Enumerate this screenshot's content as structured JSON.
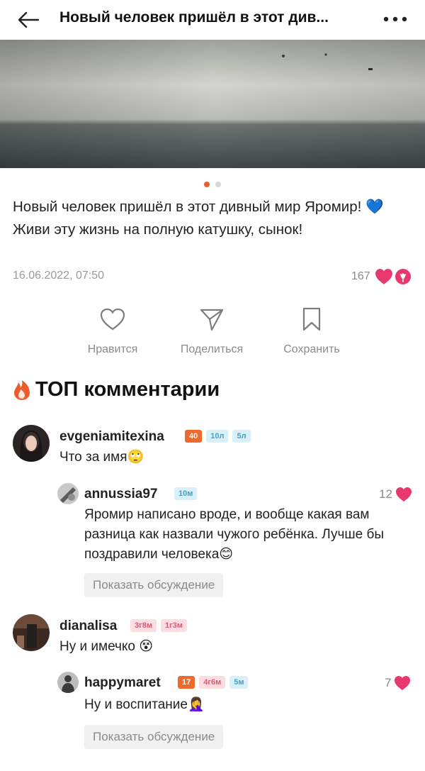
{
  "header": {
    "title": "Новый человек пришёл в этот див..."
  },
  "post": {
    "text": "Новый человек пришёл в этот дивный мир Яромир! 💙 Живи эту жизнь на полную катушку, сынок!",
    "date": "16.06.2022, 07:50",
    "likes": "167",
    "photo_slides": 2,
    "active_slide": 1
  },
  "actions": {
    "like_label": "Нравится",
    "share_label": "Поделиться",
    "save_label": "Сохранить"
  },
  "top_comments": {
    "title": "ТОП комментарии"
  },
  "comments": [
    {
      "username": "evgeniamitexina",
      "badges": [
        "40",
        "10л",
        "5л"
      ],
      "text": "Что за имя🙄",
      "reply": {
        "username": "annussia97",
        "badges": [
          "10м"
        ],
        "likes": "12",
        "text": "Яромир написано вроде, и вообще какая вам разница как назвали чужого ребёнка. Лучше бы поздравили человека😊",
        "show_discussion": "Показать обсуждение"
      }
    },
    {
      "username": "dianalisa",
      "badges": [
        "3г8м",
        "1г3м"
      ],
      "text": "Ну и имечко 😵",
      "reply": {
        "username": "happymaret",
        "badges": [
          "17",
          "4г6м",
          "5м"
        ],
        "likes": "7",
        "text": "Ну и воспитание🤦‍♀️",
        "show_discussion": "Показать обсуждение"
      }
    }
  ],
  "colors": {
    "accent": "#ee5c2c",
    "heart": "#e8386d",
    "muted": "#8a8a8a"
  }
}
